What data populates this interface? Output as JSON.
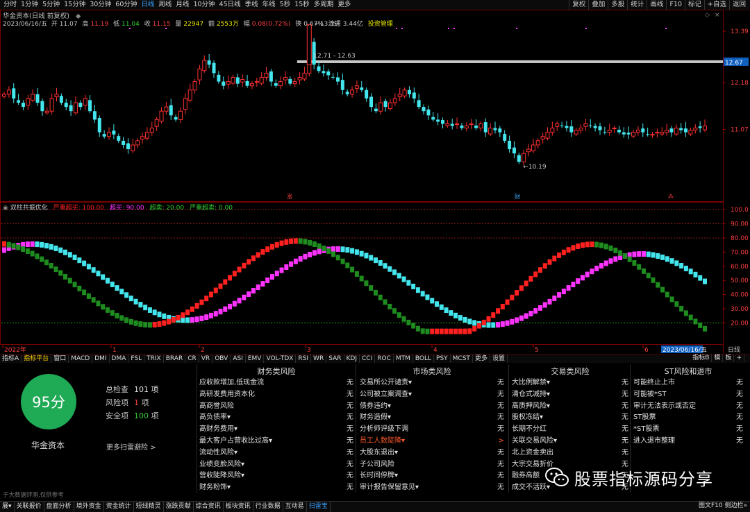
{
  "timeframes": [
    "分时",
    "1分钟",
    "5分钟",
    "15分钟",
    "30分钟",
    "60分钟",
    "日线",
    "周线",
    "月线",
    "10分钟",
    "45日线",
    "季线",
    "年线",
    "5秒",
    "15秒",
    "多周期",
    "更多"
  ],
  "active_timeframe": "日线",
  "right_buttons": [
    "复权",
    "叠加",
    "多股",
    "统计",
    "画线",
    "F10",
    "标记",
    "+自选",
    "返回"
  ],
  "info": {
    "title": "华金资本(日线 前复权)",
    "date": "2023/06/16/五",
    "open_label": "开",
    "open": "11.07",
    "high_label": "高",
    "high": "11.19",
    "low_label": "低",
    "low": "11.04",
    "close_label": "收",
    "close": "11.15",
    "vol_label": "量",
    "vol": "22947",
    "amt_label": "额",
    "amt": "2553万",
    "chg_label": "幅",
    "chg": "0.08(0.72%)",
    "turn_label": "换",
    "turn": "0.67%",
    "float_label": "流通",
    "float": "3.44亿",
    "invest": "投资管理"
  },
  "indicator": {
    "name": "双柱共振优化",
    "s1": "严重超买: 100.00",
    "s2": "超买: 90.00",
    "s3": "超卖: 20.00",
    "s4": "严重超卖: 0.00"
  },
  "chart_data": [
    {
      "type": "candlestick",
      "price_levels": [
        "13.39",
        "12.67",
        "12.18",
        "11.07"
      ],
      "current_price_tag": "12.67",
      "annotations": {
        "high": "13.59",
        "low": "10.19",
        "range": "12.71 - 12.63"
      },
      "markers": {
        "zhang": "涨",
        "cai": "财",
        "dividend": "⁂"
      },
      "ylim": [
        9.6,
        13.9
      ],
      "x_labels": [
        "2022年",
        "1",
        "2",
        "3",
        "4",
        "5",
        "6"
      ],
      "last_date_tag": "2023/06/16/五",
      "period_tag": "日线",
      "close": [
        11.9,
        12.0,
        11.8,
        11.7,
        11.6,
        11.8,
        11.9,
        11.7,
        11.5,
        11.5,
        11.8,
        11.9,
        11.7,
        11.6,
        11.5,
        11.7,
        11.6,
        11.8,
        11.5,
        11.3,
        11.0,
        10.9,
        11.0,
        10.95,
        10.8,
        10.7,
        10.6,
        10.7,
        10.8,
        10.9,
        11.0,
        11.1,
        11.3,
        11.5,
        11.6,
        11.4,
        11.3,
        11.5,
        11.8,
        12.0,
        12.2,
        12.5,
        12.7,
        12.6,
        12.4,
        12.2,
        12.1,
        12.2,
        12.3,
        12.15,
        12.25,
        12.1,
        12.15,
        12.2,
        12.3,
        12.4,
        12.2,
        12.1,
        12.2,
        12.3,
        12.15,
        12.2,
        12.3,
        12.4,
        13.1,
        12.6,
        12.45,
        12.4,
        12.35,
        12.3,
        12.2,
        12.0,
        11.9,
        12.0,
        12.1,
        12.0,
        11.8,
        11.6,
        11.5,
        11.7,
        11.6,
        11.7,
        11.8,
        11.9,
        12.0,
        11.9,
        11.8,
        11.6,
        11.5,
        11.4,
        11.3,
        11.25,
        11.2,
        11.2,
        11.15,
        11.2,
        11.1,
        11.15,
        11.2,
        11.1,
        11.2,
        11.0,
        11.1,
        11.05,
        11.0,
        10.8,
        10.6,
        10.5,
        10.3,
        10.5,
        10.6,
        10.7,
        10.8,
        10.9,
        11.0,
        11.1,
        11.2,
        11.15,
        11.1,
        11.0,
        11.05,
        11.1,
        11.2,
        11.15,
        11.1,
        11.05,
        11.0,
        11.05,
        11.1,
        11.0,
        10.95,
        10.95,
        11.0,
        11.05,
        11.0,
        10.95,
        10.95,
        11.0,
        11.0,
        11.05,
        11.0,
        11.1,
        11.05,
        11.0,
        11.05,
        11.1,
        11.1,
        11.15
      ]
    },
    {
      "type": "bar",
      "name": "双柱共振优化",
      "y_tick_labels": [
        "100.0",
        "90.00",
        "80.00",
        "70.00",
        "60.00",
        "50.00",
        "40.00",
        "30.00",
        "20.00"
      ],
      "ylim": [
        5,
        105
      ],
      "reference_lines": [
        100,
        90,
        80,
        20
      ],
      "colors": {
        "up": "#ff2020",
        "down": "#1e8c1e",
        "overbought": "#ff33ff",
        "falling": "#44e6ee"
      }
    }
  ],
  "tabs": [
    "指标A",
    "指标平台",
    "窗口",
    "MACD",
    "DMI",
    "DMA",
    "FSL",
    "TRIX",
    "BRAR",
    "CR",
    "VR",
    "OBV",
    "ASI",
    "EMV",
    "VOL-TDX",
    "RSI",
    "WR",
    "SAR",
    "KDJ",
    "CCI",
    "ROC",
    "MTM",
    "BOLL",
    "PSY",
    "MCST",
    "更多",
    "设置"
  ],
  "active_tab": "指标平台",
  "tabs_right": [
    "指标B",
    "模",
    "板",
    "+"
  ],
  "panel": {
    "score": "95分",
    "stock_name": "华金资本",
    "total_label": "总检查",
    "total": "101 项",
    "risk_label": "风险项",
    "risk": "1",
    "risk_unit": "项",
    "safe_label": "安全项",
    "safe": "100",
    "safe_unit": "项",
    "more": "更多扫雷避险 >",
    "disclaimer": "于大数据评测,仅供参考",
    "columns": [
      {
        "title": "财务类风险",
        "items": [
          {
            "name": "应收款增加,低现金流",
            "value": "无"
          },
          {
            "name": "高研发费用资本化",
            "value": "无"
          },
          {
            "name": "高商誉风险",
            "value": "无"
          },
          {
            "name": "高负债率▾",
            "value": "无"
          },
          {
            "name": "高财务费用▾",
            "value": "无"
          },
          {
            "name": "最大客户占营收比过高▾",
            "value": "无"
          },
          {
            "name": "流动性风险▾",
            "value": "无"
          },
          {
            "name": "业绩变脸风险▾",
            "value": "无"
          },
          {
            "name": "营收陡降风险▾",
            "value": "无"
          },
          {
            "name": "财务粉饰▾",
            "value": "无"
          }
        ]
      },
      {
        "title": "市场类风险",
        "items": [
          {
            "name": "交易所公开谴责▾",
            "value": "无"
          },
          {
            "name": "公司被立案调查▾",
            "value": "无"
          },
          {
            "name": "债券违约▾",
            "value": "无"
          },
          {
            "name": "财务造假▾",
            "value": "无"
          },
          {
            "name": "分析师评级下调",
            "value": "无"
          },
          {
            "name": "员工人数陡降▾",
            "value": ">",
            "warn": true
          },
          {
            "name": "大股东退出▾",
            "value": "无"
          },
          {
            "name": "子公司风险",
            "value": "无"
          },
          {
            "name": "长时间停牌▾",
            "value": "无"
          },
          {
            "name": "审计报告保留意见▾",
            "value": "无"
          }
        ]
      },
      {
        "title": "交易类风险",
        "items": [
          {
            "name": "大比例解禁▾",
            "value": "无"
          },
          {
            "name": "清仓式减持▾",
            "value": "无"
          },
          {
            "name": "高质押风险▾",
            "value": "无"
          },
          {
            "name": "股权冻结▾",
            "value": "无"
          },
          {
            "name": "长期不分红",
            "value": "无"
          },
          {
            "name": "关联交易风险▾",
            "value": "无"
          },
          {
            "name": "北上资金卖出",
            "value": "无"
          },
          {
            "name": "大宗交易折价",
            "value": "无"
          },
          {
            "name": "融券高额",
            "value": "无"
          },
          {
            "name": "成交不活跃▾",
            "value": "无"
          }
        ]
      },
      {
        "title": "ST风险和退市",
        "items": [
          {
            "name": "可能终止上市",
            "value": "无"
          },
          {
            "name": "可能被*ST",
            "value": "无"
          },
          {
            "name": "审计无法表示或否定",
            "value": "无"
          },
          {
            "name": "ST股票",
            "value": "无"
          },
          {
            "name": "*ST股票",
            "value": "无"
          },
          {
            "name": "进入退市整理",
            "value": "无"
          }
        ]
      }
    ]
  },
  "bottom_tabs": [
    "展▾",
    "关联报价",
    "盘面分析",
    "境外资金",
    "资金统计",
    "短线精灵",
    "涨跌贡献",
    "综合资讯",
    "板块资讯",
    "行业数据",
    "互动易",
    "扫雷宝"
  ],
  "active_bottom_tab": "扫雷宝",
  "bottom_right": "图文F10 侧边栏»",
  "watermark": "股票指标源码分享"
}
